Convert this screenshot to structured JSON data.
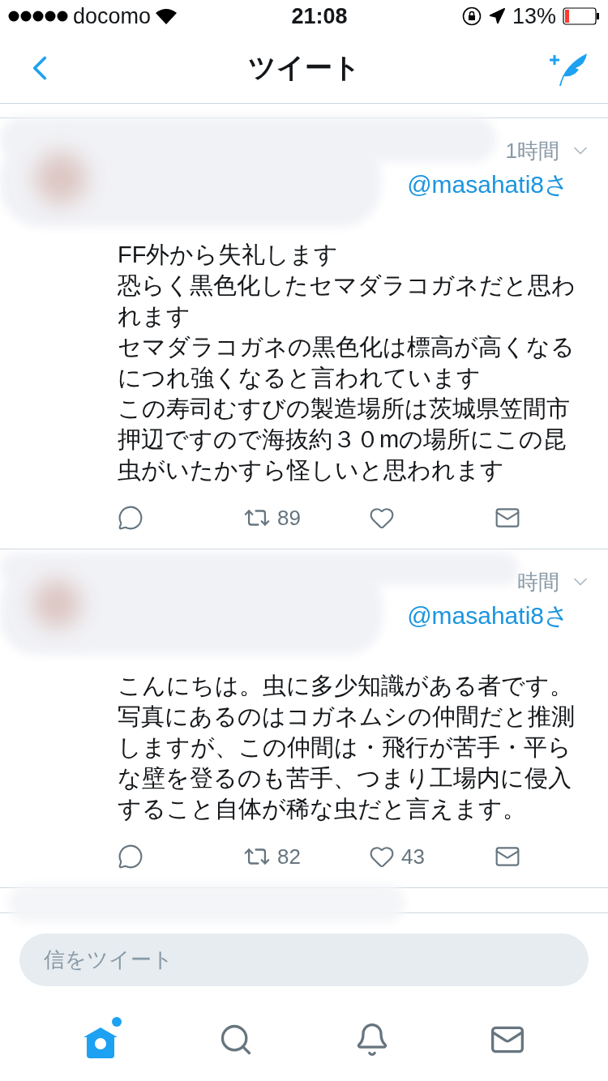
{
  "status_bar": {
    "carrier": "docomo",
    "time": "21:08",
    "battery": "13%"
  },
  "nav": {
    "title": "ツイート"
  },
  "tweets": [
    {
      "time": "1時間",
      "reply_to": "@masahati8さ",
      "paragraphs": [
        "FF外から失礼します",
        "恐らく黒色化したセマダラコガネだと思われます",
        "セマダラコガネの黒色化は標高が高くなるにつれ強くなると言われています",
        "この寿司むすびの製造場所は茨城県笠間市押辺ですので海抜約３０mの場所にこの昆虫がいたかすら怪しいと思われます"
      ],
      "retweets": "89"
    },
    {
      "time": "時間",
      "reply_to": "@masahati8さ",
      "paragraphs": [
        "こんにちは。虫に多少知識がある者です。写真にあるのはコガネムシの仲間だと推測しますが、この仲間は・飛行が苦手・平らな壁を登るのも苦手、つまり工場内に侵入すること自体が稀な虫だと言えます。"
      ],
      "retweets": "82",
      "likes": "43"
    }
  ],
  "reply_field": {
    "placeholder": "信をツイート"
  },
  "tabs": [
    {
      "kind": "home",
      "selected": true,
      "unread": true
    },
    {
      "kind": "search",
      "selected": false,
      "unread": false
    },
    {
      "kind": "notifications",
      "selected": false,
      "unread": false
    },
    {
      "kind": "messages",
      "selected": false,
      "unread": false
    }
  ]
}
